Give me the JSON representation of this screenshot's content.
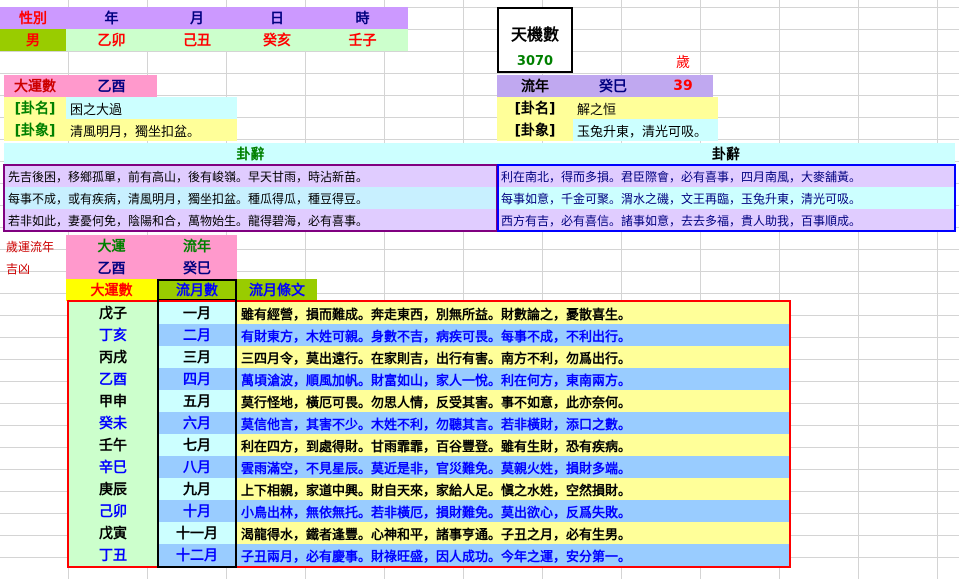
{
  "header": {
    "labels": [
      "性別",
      "年",
      "月",
      "日",
      "時"
    ],
    "values": [
      "男",
      "乙卯",
      "己丑",
      "癸亥",
      "壬子"
    ]
  },
  "tianji": {
    "title": "天機數",
    "number": "3070",
    "sui_label": "歲"
  },
  "left_block": {
    "dayun_label": "大運數",
    "dayun_value": "乙酉",
    "guaming_label": "[卦名]",
    "guaming_value": "困之大過",
    "guaxiang_label": "[卦象]",
    "guaxiang_value": "清風明月，獨坐扣盆。",
    "guaci_title": "卦辭",
    "guaci_lines": [
      "先吉後困，移鄉孤單，前有高山，後有峻嶺。早天甘雨，時沾新苗。",
      "每事不成，或有疾病，清風明月，獨坐扣盆。種瓜得瓜，種豆得豆。",
      "若非如此，妻憂何免，陰陽和合，萬物始生。龍得碧海，必有喜事。"
    ]
  },
  "right_block": {
    "liunian_label": "流年",
    "liunian_value": "癸巳",
    "age": "39",
    "guaming_label": "[卦名]",
    "guaming_value": "解之恒",
    "guaxiang_label": "[卦象]",
    "guaxiang_value": "玉兔升東，清光可吸。",
    "guaci_title": "卦辭",
    "guaci_lines": [
      "利在南北，得而多損。君臣際會，必有喜事，四月南風，大麥舖黃。",
      "每事如意，千金可聚。渭水之磯，文王再臨，玉兔升東，清光可吸。",
      "西方有吉，必有喜信。諸事如意，去去多福，貴人助我，百事順成。"
    ]
  },
  "monthly": {
    "side_title": "歲運流年",
    "side_title2": "吉凶",
    "dayun_head": "大運",
    "liunian_head": "流年",
    "dayun_val": "乙酉",
    "liunian_val": "癸巳",
    "col_headers": [
      "大運數",
      "流月數",
      "流月條文"
    ],
    "rows": [
      {
        "gz": "戊子",
        "month": "一月",
        "text": "雖有經營，損而難成。奔走東西，別無所益。財數論之，憂散喜生。"
      },
      {
        "gz": "丁亥",
        "month": "二月",
        "text": "有財東方，木姓可親。身數不吉，病疾可畏。每事不成，不利出行。"
      },
      {
        "gz": "丙戌",
        "month": "三月",
        "text": "三四月令，莫出遠行。在家則吉，出行有害。南方不利，勿爲出行。"
      },
      {
        "gz": "乙酉",
        "month": "四月",
        "text": "萬頃滄波，順風加帆。財富如山，家人一悅。利在何方，東南兩方。"
      },
      {
        "gz": "甲申",
        "month": "五月",
        "text": "莫行怪地，橫厄可畏。勿思人情，反受其害。事不如意，此亦奈何。"
      },
      {
        "gz": "癸未",
        "month": "六月",
        "text": "莫信他言，其害不少。木姓不利，勿聽其言。若非橫財，添口之數。"
      },
      {
        "gz": "壬午",
        "month": "七月",
        "text": "利在四方，到處得財。甘雨霏霏，百谷豐登。雖有生財，恐有疾病。"
      },
      {
        "gz": "辛巳",
        "month": "八月",
        "text": "雲雨滿空，不見星辰。莫近是非，官災難免。莫親火姓，損財多端。"
      },
      {
        "gz": "庚辰",
        "month": "九月",
        "text": "上下相親，家道中興。財自天來，家給人足。愼之水姓，空然損財。"
      },
      {
        "gz": "己卯",
        "month": "十月",
        "text": "小鳥出林，無依無托。若非橫厄，損財難免。莫出欲心，反爲失敗。"
      },
      {
        "gz": "戊寅",
        "month": "十一月",
        "text": "渴龍得水，鐵者逢豐。心神和平，諸事亨通。子丑之月，必有生男。"
      },
      {
        "gz": "丁丑",
        "month": "十二月",
        "text": "子丑兩月，必有慶事。財祿旺盛，因人成功。今年之運，安分第一。"
      }
    ]
  }
}
